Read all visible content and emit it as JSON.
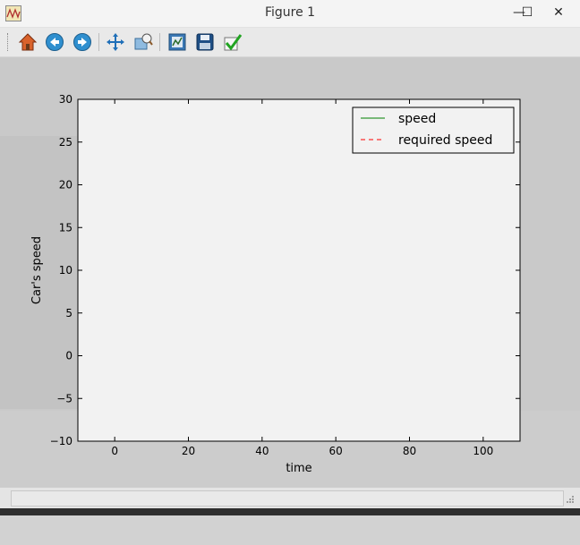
{
  "window": {
    "title": "Figure 1",
    "minimize_glyph": "—",
    "maximize_glyph": "☐",
    "close_glyph": "✕"
  },
  "toolbar": {
    "tools": [
      {
        "name": "home-icon",
        "tooltip": "Reset original view"
      },
      {
        "name": "back-icon",
        "tooltip": "Back to previous view"
      },
      {
        "name": "forward-icon",
        "tooltip": "Forward to next view"
      },
      {
        "name": "pan-icon",
        "tooltip": "Pan axes"
      },
      {
        "name": "zoom-icon",
        "tooltip": "Zoom to rectangle"
      },
      {
        "name": "subplots-icon",
        "tooltip": "Configure subplots"
      },
      {
        "name": "save-icon",
        "tooltip": "Save the figure"
      },
      {
        "name": "edit-icon",
        "tooltip": "Edit curves"
      }
    ]
  },
  "chart_data": {
    "type": "line",
    "title": "",
    "xlabel": "time",
    "ylabel": "Car's speed",
    "xlim": [
      -10,
      110
    ],
    "ylim": [
      -10,
      30
    ],
    "xticks": [
      0,
      20,
      40,
      60,
      80,
      100
    ],
    "yticks": [
      -10,
      -5,
      0,
      5,
      10,
      15,
      20,
      25,
      30
    ],
    "grid": false,
    "legend_position": "top-right",
    "series": [
      {
        "name": "speed",
        "color": "#008000",
        "style": "solid",
        "x": [],
        "y": []
      },
      {
        "name": "required speed",
        "color": "#ff0000",
        "style": "dashed",
        "x": [],
        "y": []
      }
    ]
  }
}
